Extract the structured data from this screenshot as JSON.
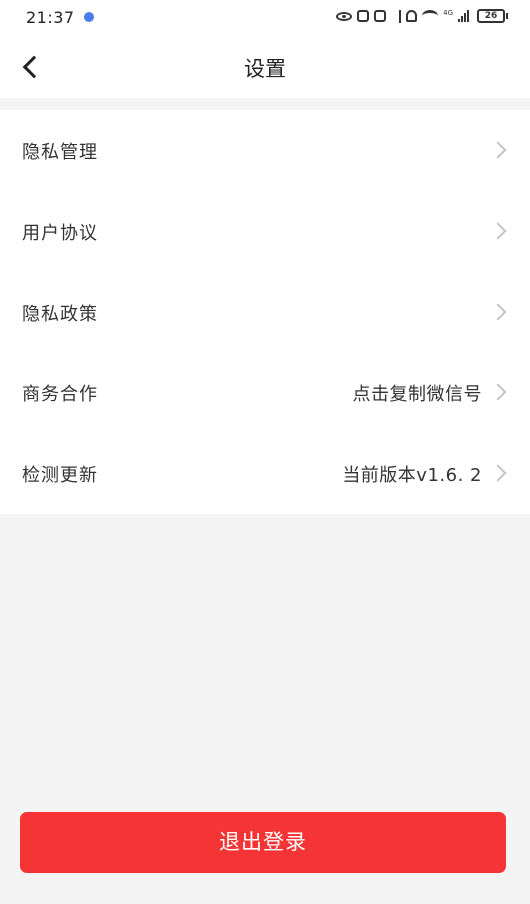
{
  "status_bar": {
    "time": "21:37",
    "network": "4G",
    "battery": "26"
  },
  "header": {
    "title": "设置"
  },
  "settings": [
    {
      "label": "隐私管理",
      "value": ""
    },
    {
      "label": "用户协议",
      "value": ""
    },
    {
      "label": "隐私政策",
      "value": ""
    },
    {
      "label": "商务合作",
      "value": "点击复制微信号"
    },
    {
      "label": "检测更新",
      "value": "当前版本v1.6. 2"
    }
  ],
  "footer": {
    "logout_label": "退出登录"
  },
  "colors": {
    "accent": "#f53535",
    "background": "#f4f4f4",
    "surface": "#ffffff",
    "chevron": "#c4c4c4"
  }
}
